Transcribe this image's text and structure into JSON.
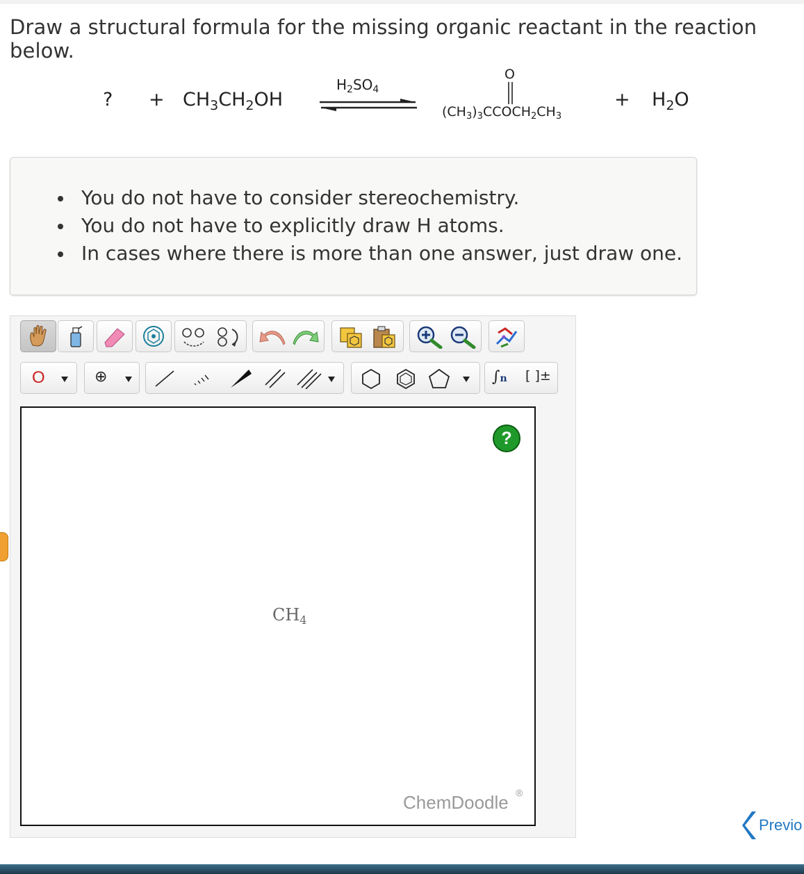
{
  "question": {
    "prompt": "Draw a structural formula for the missing organic reactant in the reaction below."
  },
  "reaction": {
    "unknown": "?",
    "plus1": "+",
    "reactant_main": "CH",
    "reactant_sub1": "3",
    "reactant_mid": "CH",
    "reactant_sub2": "2",
    "reactant_end": "OH",
    "catalyst_h": "H",
    "catalyst_sub1": "2",
    "catalyst_so": "SO",
    "catalyst_sub2": "4",
    "product_carbonyl_o": "O",
    "product_part1": "(CH",
    "product_sub1": "3",
    "product_part2": ")",
    "product_sub2": "3",
    "product_part3": "CCOCH",
    "product_sub3": "2",
    "product_part4": "CH",
    "product_sub4": "3",
    "plus2": "+",
    "water_h": "H",
    "water_sub": "2",
    "water_o": "O"
  },
  "instructions": [
    "You do not have to consider stereochemistry.",
    "You do not have to explicitly draw H atoms.",
    "In cases where there is more than one answer, just draw one."
  ],
  "toolbar": {
    "atom_label": "O",
    "charge_symbol": "⊕",
    "polymer_n": "n",
    "bracket_label": "[ ]±"
  },
  "canvas": {
    "molecule_main": "CH",
    "molecule_sub": "4",
    "help_label": "?",
    "brand": "ChemDoodle",
    "brand_mark": "®"
  },
  "navigation": {
    "previous_label": "Previo"
  },
  "colors": {
    "accent_blue": "#2178c4",
    "help_green": "#1f9a2a",
    "atom_red": "#cc2222",
    "warning_orange": "#f0a030"
  }
}
